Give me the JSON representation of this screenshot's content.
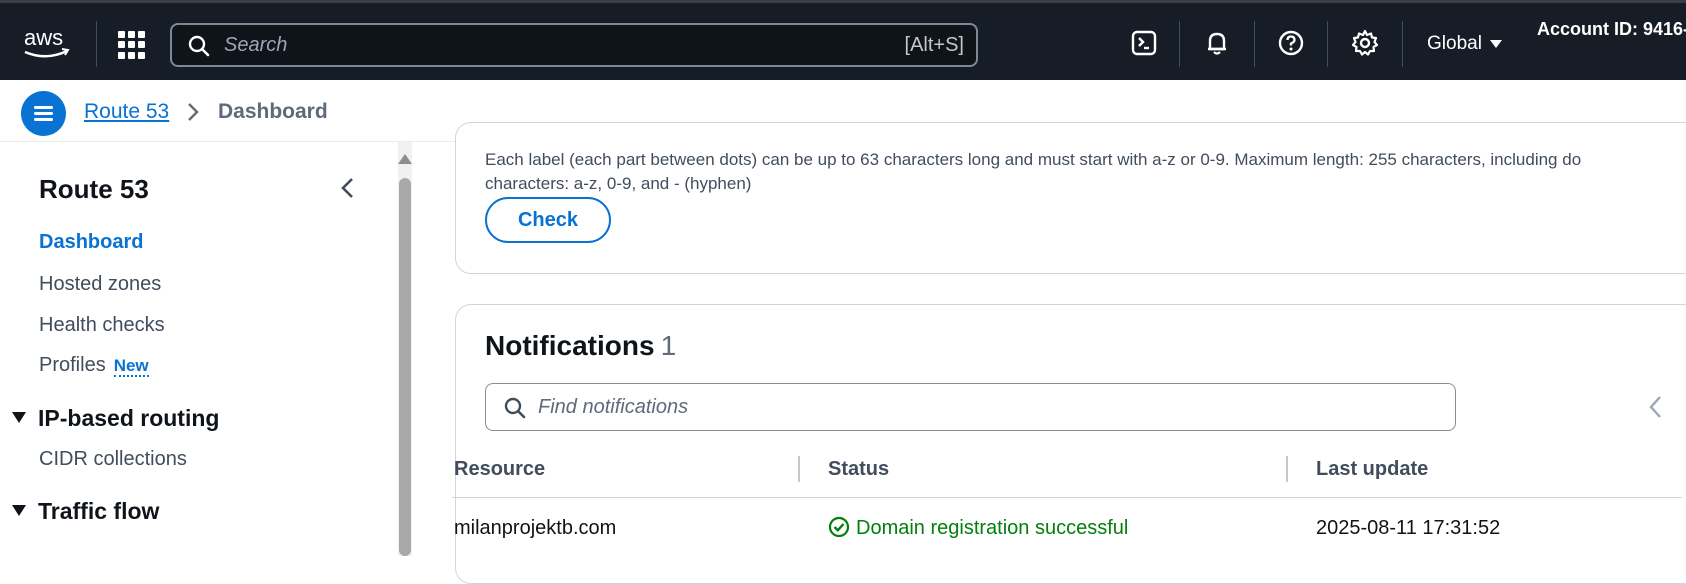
{
  "topnav": {
    "logo": "aws",
    "search_placeholder": "Search",
    "search_shortcut": "[Alt+S]",
    "region": "Global",
    "account_id": "Account ID: 9416-",
    "icons": [
      "cloudshell-icon",
      "notifications-icon",
      "help-icon",
      "settings-icon"
    ]
  },
  "breadcrumb": {
    "items": [
      "Route 53",
      "Dashboard"
    ]
  },
  "sidebar": {
    "title": "Route 53",
    "items": [
      {
        "label": "Dashboard",
        "active": true
      },
      {
        "label": "Hosted zones"
      },
      {
        "label": "Health checks"
      },
      {
        "label": "Profiles",
        "badge": "New"
      }
    ],
    "sections": [
      {
        "label": "IP-based routing",
        "items": [
          "CIDR collections"
        ]
      },
      {
        "label": "Traffic flow"
      }
    ]
  },
  "domain_check": {
    "help_line1": "Each label (each part between dots) can be up to 63 characters long and must start with a-z or 0-9. Maximum length: 255 characters, including do",
    "help_line2": "characters: a-z, 0-9, and - (hyphen)",
    "check_label": "Check"
  },
  "notifications": {
    "title": "Notifications",
    "count": "1",
    "search_placeholder": "Find notifications",
    "columns": [
      "Resource",
      "Status",
      "Last update"
    ],
    "rows": [
      {
        "resource": "milanprojektb.com",
        "status": "Domain registration successful",
        "last_update": "2025-08-11 17:31:52"
      }
    ]
  },
  "colors": {
    "nav_bg": "#161d26",
    "link": "#0972d3",
    "success": "#037f0c"
  }
}
